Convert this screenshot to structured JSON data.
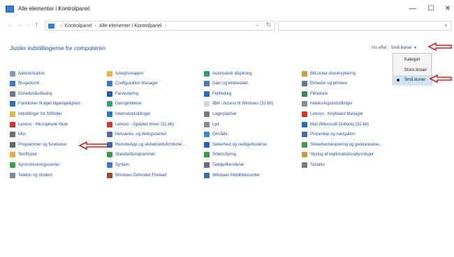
{
  "window": {
    "title": "Alle elementer i Kontrolpanel",
    "controls": {
      "minimize": "—",
      "maximize": "☐",
      "close": "✕"
    }
  },
  "nav": {
    "back": "←",
    "forward": "→",
    "history": "⌄",
    "up": "↑",
    "address": {
      "part1": "Kontrolpanel",
      "part2": "Alle elementer i Kontrolpanel",
      "sep": "›",
      "dropdown": "⌄",
      "refresh": "↻"
    },
    "search_glyph": "⌕"
  },
  "header": {
    "title": "Juster indstillingerne for computeren",
    "view_by_label": "Vis efter:",
    "view_by_value": "Små ikoner",
    "view_by_caret": "▼"
  },
  "view_menu": {
    "items": [
      "Kategori",
      "Store ikoner",
      "Små ikoner"
    ],
    "selected": 2
  },
  "columns": [
    [
      {
        "label": "Administration",
        "icon": "admin-tools-icon",
        "color": "#8a9bb0"
      },
      {
        "label": "Brugerkonti",
        "icon": "user-accounts-icon",
        "color": "#3c78c8"
      },
      {
        "label": "Enhedshåndtering",
        "icon": "device-manager-icon",
        "color": "#6a7a8a"
      },
      {
        "label": "Funktioner til øget tilgængelighed",
        "icon": "ease-of-access-icon",
        "color": "#2a6ec8"
      },
      {
        "label": "Indstillinger for Stifinder",
        "icon": "folder-options-icon",
        "color": "#e0b64a"
      },
      {
        "label": "Lenovo - Microphone Mute",
        "icon": "lenovo-mic-icon",
        "color": "#d9342b"
      },
      {
        "label": "Mus",
        "icon": "mouse-icon",
        "color": "#6b6b6b"
      },
      {
        "label": "Programmer og funktioner",
        "icon": "programs-icon",
        "color": "#5a6a5a"
      },
      {
        "label": "Skrifttyper",
        "icon": "fonts-icon",
        "color": "#e2b03a"
      },
      {
        "label": "Synkroniseringscenter",
        "icon": "sync-center-icon",
        "color": "#3aa046"
      },
      {
        "label": "Telefon og modem",
        "icon": "phone-modem-icon",
        "color": "#7a8a9a"
      }
    ],
    [
      {
        "label": "Arbejdsmapper",
        "icon": "work-folders-icon",
        "color": "#e0b64a"
      },
      {
        "label": "Configuration Manager",
        "icon": "config-manager-icon",
        "color": "#3a7ac8"
      },
      {
        "label": "Farvestyring",
        "icon": "color-management-icon",
        "color": "#2a5aa8"
      },
      {
        "label": "Genopretteise",
        "icon": "recovery-icon",
        "color": "#3a9a7a"
      },
      {
        "label": "Internetindstillinger",
        "icon": "internet-options-icon",
        "color": "#2a7ac8"
      },
      {
        "label": "Lenovo - Opdater driver (32-bit)",
        "icon": "lenovo-update-icon",
        "color": "#d9342b"
      },
      {
        "label": "Netværks- og delingscenter",
        "icon": "network-center-icon",
        "color": "#4a6ab0"
      },
      {
        "label": "RemoteApp og skrivebordsforbindel...",
        "icon": "remoteapp-icon",
        "color": "#2a6ab8"
      },
      {
        "label": "Standardprogrammer",
        "icon": "default-programs-icon",
        "color": "#3a9a4a"
      },
      {
        "label": "System",
        "icon": "system-icon",
        "color": "#3a7ac8"
      },
      {
        "label": "Windows Defender Firewall",
        "icon": "firewall-icon",
        "color": "#9a4a2a"
      }
    ],
    [
      {
        "label": "Automatisk afspilning",
        "icon": "autoplay-icon",
        "color": "#3a9a6a"
      },
      {
        "label": "Dato og klokkeslæt",
        "icon": "date-time-icon",
        "color": "#4a7ab8"
      },
      {
        "label": "Fejlfinding",
        "icon": "troubleshooting-icon",
        "color": "#2a6ab8"
      },
      {
        "label": "IBM i Access til Windows (32-bit)",
        "icon": "ibm-access-icon",
        "color": "#d8d8d8"
      },
      {
        "label": "Lagerpladser",
        "icon": "storage-spaces-icon",
        "color": "#7a7a7a"
      },
      {
        "label": "Lyd",
        "icon": "sound-icon",
        "color": "#8a8a8a"
      },
      {
        "label": "Område",
        "icon": "region-icon",
        "color": "#3a8ac8"
      },
      {
        "label": "Sikkerhed og vedligeholdelse",
        "icon": "security-maintenance-icon",
        "color": "#2a5ab8"
      },
      {
        "label": "Strømstyring",
        "icon": "power-options-icon",
        "color": "#3a9a4a"
      },
      {
        "label": "Talegenkendelse",
        "icon": "speech-recognition-icon",
        "color": "#6a6a7a"
      },
      {
        "label": "Windows Mobilitetscenter",
        "icon": "mobility-center-icon",
        "color": "#3a6ab8"
      }
    ],
    [
      {
        "label": "BitLocker-drevkryptering",
        "icon": "bitlocker-icon",
        "color": "#c8a040"
      },
      {
        "label": "Enheder og printere",
        "icon": "devices-printers-icon",
        "color": "#5a7a9a"
      },
      {
        "label": "Filhistorik",
        "icon": "file-history-icon",
        "color": "#3a8a4a"
      },
      {
        "label": "Indeksringsindstillinger",
        "icon": "indexing-options-icon",
        "color": "#8a8a9a"
      },
      {
        "label": "Lenovo - Keyboard Manager",
        "icon": "lenovo-keyboard-icon",
        "color": "#d9342b"
      },
      {
        "label": "Mail (Microsoft Outlook) (32-bit)",
        "icon": "mail-icon",
        "color": "#2a6ab8"
      },
      {
        "label": "Procesliije og navigation",
        "icon": "taskbar-navigation-icon",
        "color": "#4a6a9a"
      },
      {
        "label": "Sikkerhedskopiering og gendannelse...",
        "icon": "backup-restore-icon",
        "color": "#3a9a4a"
      },
      {
        "label": "Styring af legitimationsoplysninger",
        "icon": "credential-manager-icon",
        "color": "#c89a3a"
      },
      {
        "label": "Tastatur",
        "icon": "keyboard-icon",
        "color": "#7a7a7a"
      }
    ]
  ],
  "accent": "#1e4e9c",
  "annotation_color": "#d81e1e"
}
